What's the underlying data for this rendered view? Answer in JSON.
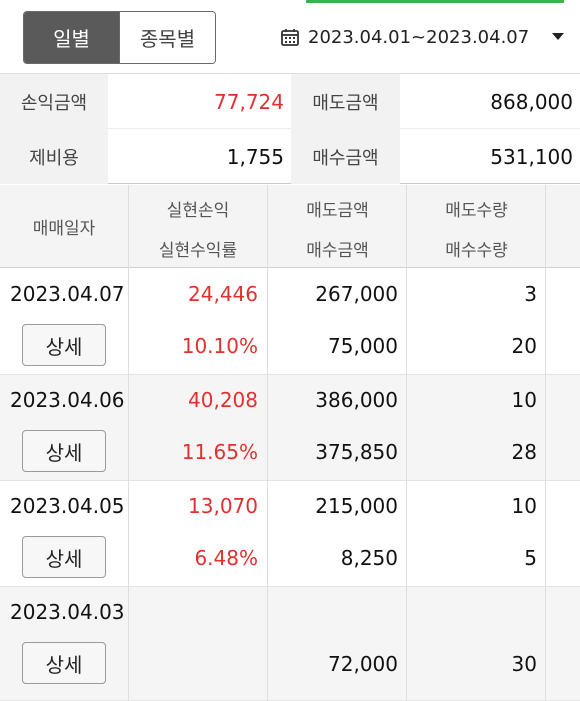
{
  "toggle": {
    "daily": "일별",
    "by_stock": "종목별"
  },
  "date_range": {
    "label": "2023.04.01~2023.04.07",
    "icon": "calendar-icon"
  },
  "summary": {
    "pnl_label": "손익금액",
    "pnl_value": "77,724",
    "sell_label": "매도금액",
    "sell_value": "868,000",
    "fee_label": "제비용",
    "fee_value": "1,755",
    "buy_label": "매수금액",
    "buy_value": "531,100"
  },
  "table": {
    "headers": {
      "date": "매매일자",
      "realized_pnl": "실현손익",
      "realized_rate": "실현수익률",
      "sell_amount": "매도금액",
      "buy_amount": "매수금액",
      "sell_qty": "매도수량",
      "buy_qty": "매수수량"
    },
    "rows": [
      {
        "date": "2023.04.07",
        "pnl": "24,446",
        "rate": "10.10%",
        "sell_amt": "267,000",
        "buy_amt": "75,000",
        "sell_qty": "3",
        "buy_qty": "20",
        "detail": "상세"
      },
      {
        "date": "2023.04.06",
        "pnl": "40,208",
        "rate": "11.65%",
        "sell_amt": "386,000",
        "buy_amt": "375,850",
        "sell_qty": "10",
        "buy_qty": "28",
        "detail": "상세"
      },
      {
        "date": "2023.04.05",
        "pnl": "13,070",
        "rate": "6.48%",
        "sell_amt": "215,000",
        "buy_amt": "8,250",
        "sell_qty": "10",
        "buy_qty": "5",
        "detail": "상세"
      },
      {
        "date": "2023.04.03",
        "pnl": "",
        "rate": "",
        "sell_amt": "",
        "buy_amt": "72,000",
        "sell_qty": "",
        "buy_qty": "30",
        "detail": "상세"
      }
    ]
  },
  "colors": {
    "profit": "#e03030",
    "accent": "#3bb54a",
    "toggle_active": "#5a5a5a"
  }
}
